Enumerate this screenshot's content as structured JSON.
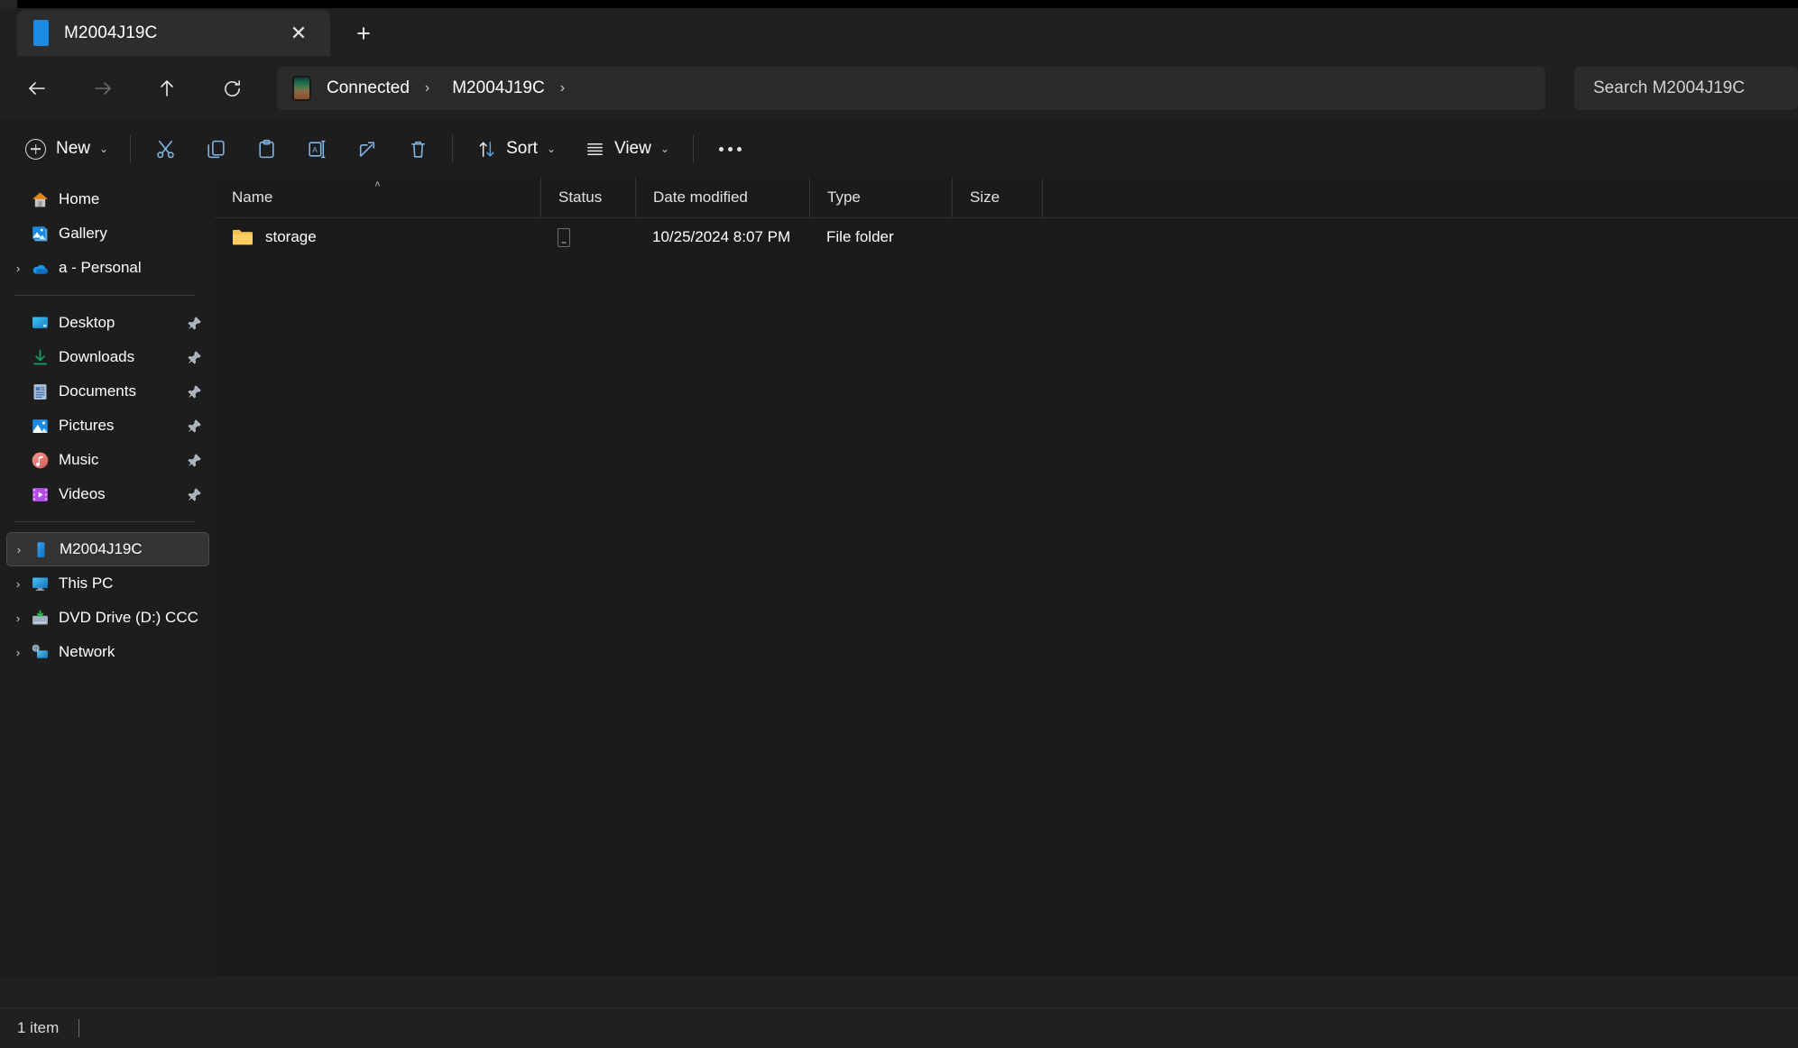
{
  "window": {
    "tab": {
      "title": "M2004J19C",
      "close_label": "✕",
      "new_tab_label": "+"
    }
  },
  "nav": {
    "back": "←",
    "forward": "→",
    "up": "↑",
    "refresh": "⟳"
  },
  "address": {
    "crumbs": [
      {
        "label": "Connected",
        "icon": "phone-icon"
      },
      {
        "label": "M2004J19C",
        "icon": ""
      }
    ],
    "separator": "›",
    "trailing_separator": "›"
  },
  "search": {
    "placeholder": "Search M2004J19C",
    "value": ""
  },
  "toolbar": {
    "new_label": "New",
    "new_chevron": "⌄",
    "cut_label": "Cut",
    "copy_label": "Copy",
    "paste_label": "Paste",
    "rename_label": "Rename",
    "share_label": "Share",
    "delete_label": "Delete",
    "sort_label": "Sort",
    "sort_chevron": "⌄",
    "view_label": "View",
    "view_chevron": "⌄",
    "more_label": "See more"
  },
  "sidebar": {
    "items": [
      {
        "label": "Home",
        "icon": "home-icon",
        "expander": false,
        "pinned": false,
        "selected": false
      },
      {
        "label": "Gallery",
        "icon": "gallery-icon",
        "expander": false,
        "pinned": false,
        "selected": false
      },
      {
        "label": "a - Personal",
        "icon": "onedrive-icon",
        "expander": true,
        "pinned": false,
        "selected": false
      },
      {
        "label": "Desktop",
        "icon": "desktop-icon",
        "expander": false,
        "pinned": true,
        "selected": false
      },
      {
        "label": "Downloads",
        "icon": "downloads-icon",
        "expander": false,
        "pinned": true,
        "selected": false
      },
      {
        "label": "Documents",
        "icon": "documents-icon",
        "expander": false,
        "pinned": true,
        "selected": false
      },
      {
        "label": "Pictures",
        "icon": "pictures-icon",
        "expander": false,
        "pinned": true,
        "selected": false
      },
      {
        "label": "Music",
        "icon": "music-icon",
        "expander": false,
        "pinned": true,
        "selected": false
      },
      {
        "label": "Videos",
        "icon": "videos-icon",
        "expander": false,
        "pinned": true,
        "selected": false
      },
      {
        "label": "M2004J19C",
        "icon": "phone-icon",
        "expander": true,
        "pinned": false,
        "selected": true
      },
      {
        "label": "This PC",
        "icon": "thispc-icon",
        "expander": true,
        "pinned": false,
        "selected": false
      },
      {
        "label": "DVD Drive (D:) CCC",
        "icon": "dvd-icon",
        "expander": true,
        "pinned": false,
        "selected": false
      },
      {
        "label": "Network",
        "icon": "network-icon",
        "expander": true,
        "pinned": false,
        "selected": false
      }
    ],
    "expander_glyph": "›",
    "pin_glyph": "📌"
  },
  "filelist": {
    "columns": [
      {
        "key": "name",
        "label": "Name",
        "sorted": "asc"
      },
      {
        "key": "status",
        "label": "Status",
        "sorted": ""
      },
      {
        "key": "date",
        "label": "Date modified",
        "sorted": ""
      },
      {
        "key": "type",
        "label": "Type",
        "sorted": ""
      },
      {
        "key": "size",
        "label": "Size",
        "sorted": ""
      }
    ],
    "sort_caret": "˄",
    "rows": [
      {
        "name": "storage",
        "icon": "folder-icon",
        "status": "mobile-device-glyph",
        "date": "10/25/2024 8:07 PM",
        "type": "File folder",
        "size": ""
      }
    ]
  },
  "statusbar": {
    "item_count": "1 item"
  },
  "colors": {
    "window_bg": "#202020",
    "surface_bg": "#1d1d1d",
    "content_bg": "#1b1b1b",
    "tab_bg": "#2d2d2d",
    "accent_blue": "#1b8ae0",
    "folder_yellow": "#ffc34d",
    "text_primary": "#ffffff",
    "text_secondary": "#d2d2d2"
  }
}
